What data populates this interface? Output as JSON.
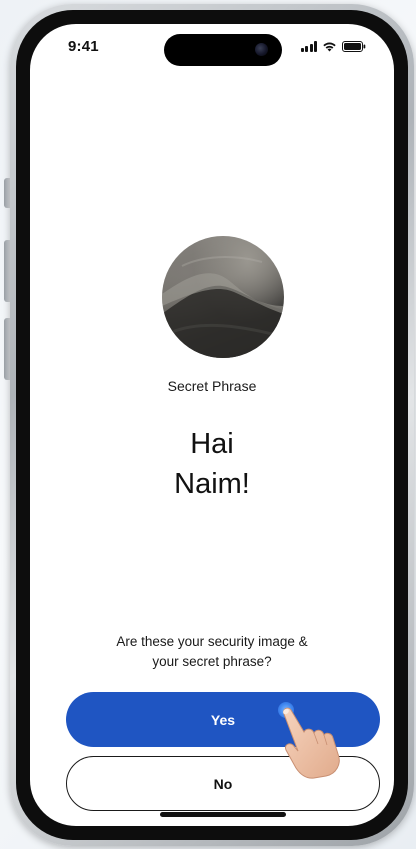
{
  "status_bar": {
    "time": "9:41",
    "icons": [
      "signal-icon",
      "wifi-icon",
      "battery-icon"
    ]
  },
  "security_image": {
    "description_icon": "sand-dune-image"
  },
  "secret_phrase": {
    "label": "Secret Phrase",
    "greeting_line1": "Hai",
    "greeting_line2": "Naim!"
  },
  "question": {
    "line1": "Are these your security image &",
    "line2": "your secret phrase?"
  },
  "buttons": {
    "yes_label": "Yes",
    "no_label": "No"
  },
  "colors": {
    "primary": "#1f55c2",
    "background": "#ffffff",
    "text": "#111111"
  }
}
